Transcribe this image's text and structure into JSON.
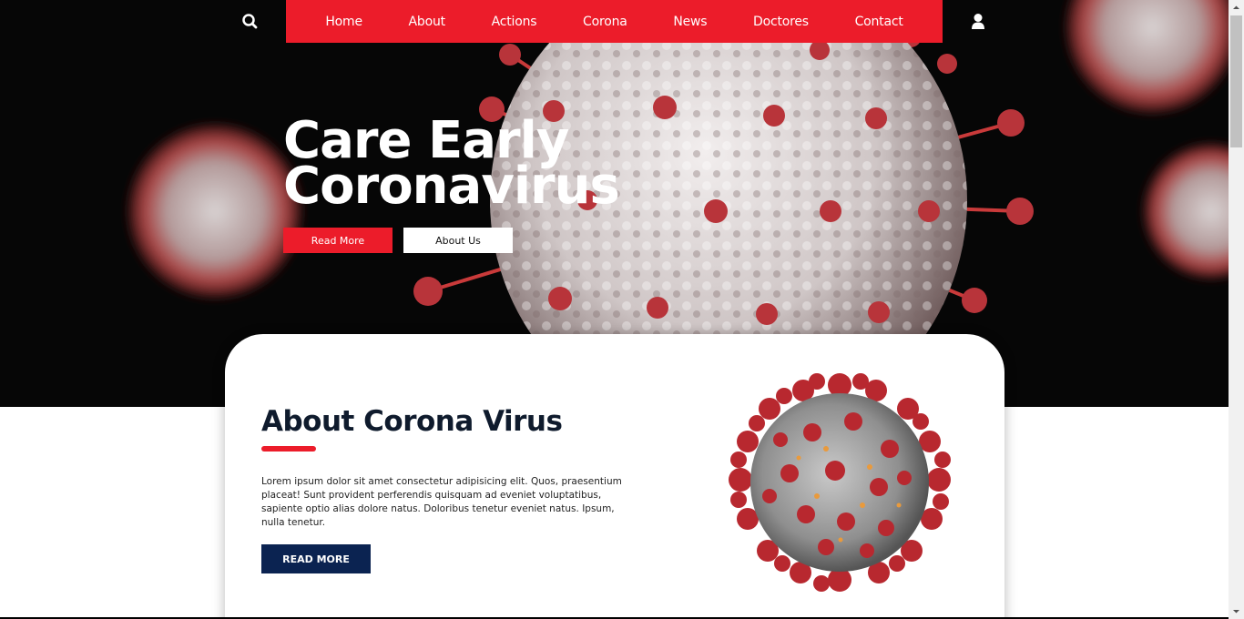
{
  "nav": {
    "search_icon": "search-icon",
    "user_icon": "user-icon",
    "links": [
      "Home",
      "About",
      "Actions",
      "Corona",
      "News",
      "Doctores",
      "Contact"
    ],
    "accent_color": "#ec1c2a"
  },
  "hero": {
    "title_line1": "Care Early",
    "title_line2": "Coronavirus",
    "read_more_label": "Read More",
    "about_us_label": "About Us"
  },
  "about": {
    "title": "About Corona Virus",
    "body": "Lorem ipsum dolor sit amet consectetur adipisicing elit. Quos, praesentium placeat! Sunt provident perferendis quisquam ad eveniet voluptatibus, sapiente optio alias dolore natus. Doloribus tenetur eveniet natus. Ipsum, nulla tenetur.",
    "button_label": "READ MORE",
    "button_color": "#0b2351"
  }
}
